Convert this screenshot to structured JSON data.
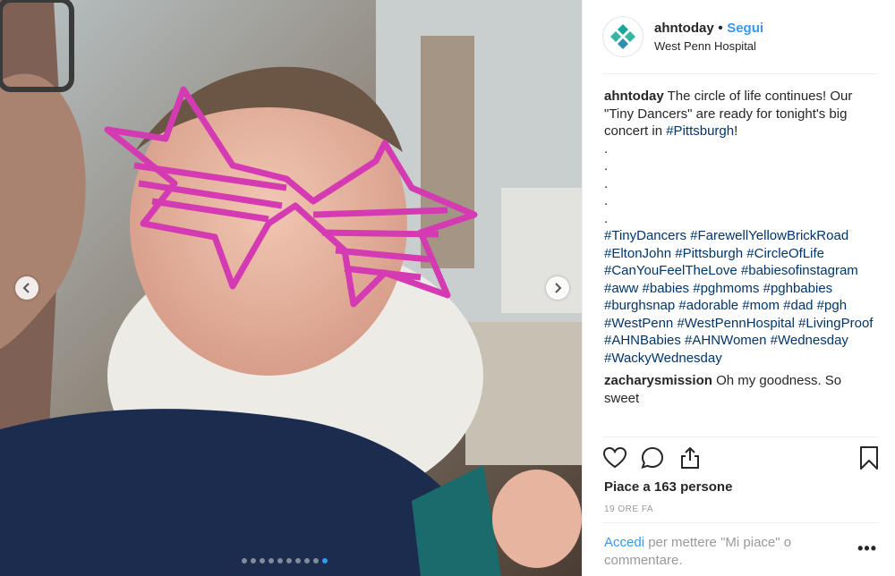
{
  "post": {
    "username": "ahntoday",
    "follow_label": "Segui",
    "separator": "•",
    "location": "West Penn Hospital"
  },
  "caption": {
    "username": "ahntoday",
    "text": "The circle of life continues! Our \"Tiny Dancers\" are ready for tonight's big concert in",
    "inline_tag": "#Pittsburgh",
    "end": "!",
    "dots": [
      ".",
      ".",
      ".",
      ".",
      "."
    ],
    "hashtags_text": "#TinyDancers #FarewellYellowBrickRoad #EltonJohn #Pittsburgh #CircleOfLife #CanYouFeelTheLove #babiesofinstagram #aww #babies #pghmoms #pghbabies #burghsnap #adorable #mom #dad #pgh #WestPenn #WestPennHospital #LivingProof #AHNBabies #AHNWomen #Wednesday #WackyWednesday"
  },
  "comment": {
    "username": "zacharysmission",
    "text": "Oh my goodness. So sweet"
  },
  "likes": "Piace a 163 persone",
  "time": "19 ORE FA",
  "login": {
    "link": "Accedi",
    "rest": "per mettere \"Mi piace\" o commentare."
  },
  "more": "•••",
  "carousel": {
    "count": 10,
    "active_index": 9
  },
  "icons": {
    "avatar": "ahn-logo-icon",
    "prev": "chevron-left-icon",
    "next": "chevron-right-icon",
    "like": "heart-icon",
    "comment": "comment-icon",
    "share": "share-icon",
    "save": "bookmark-icon"
  },
  "colors": {
    "accent": "#3897f0",
    "hashtag": "#003569",
    "brand": "#1aa59b"
  }
}
